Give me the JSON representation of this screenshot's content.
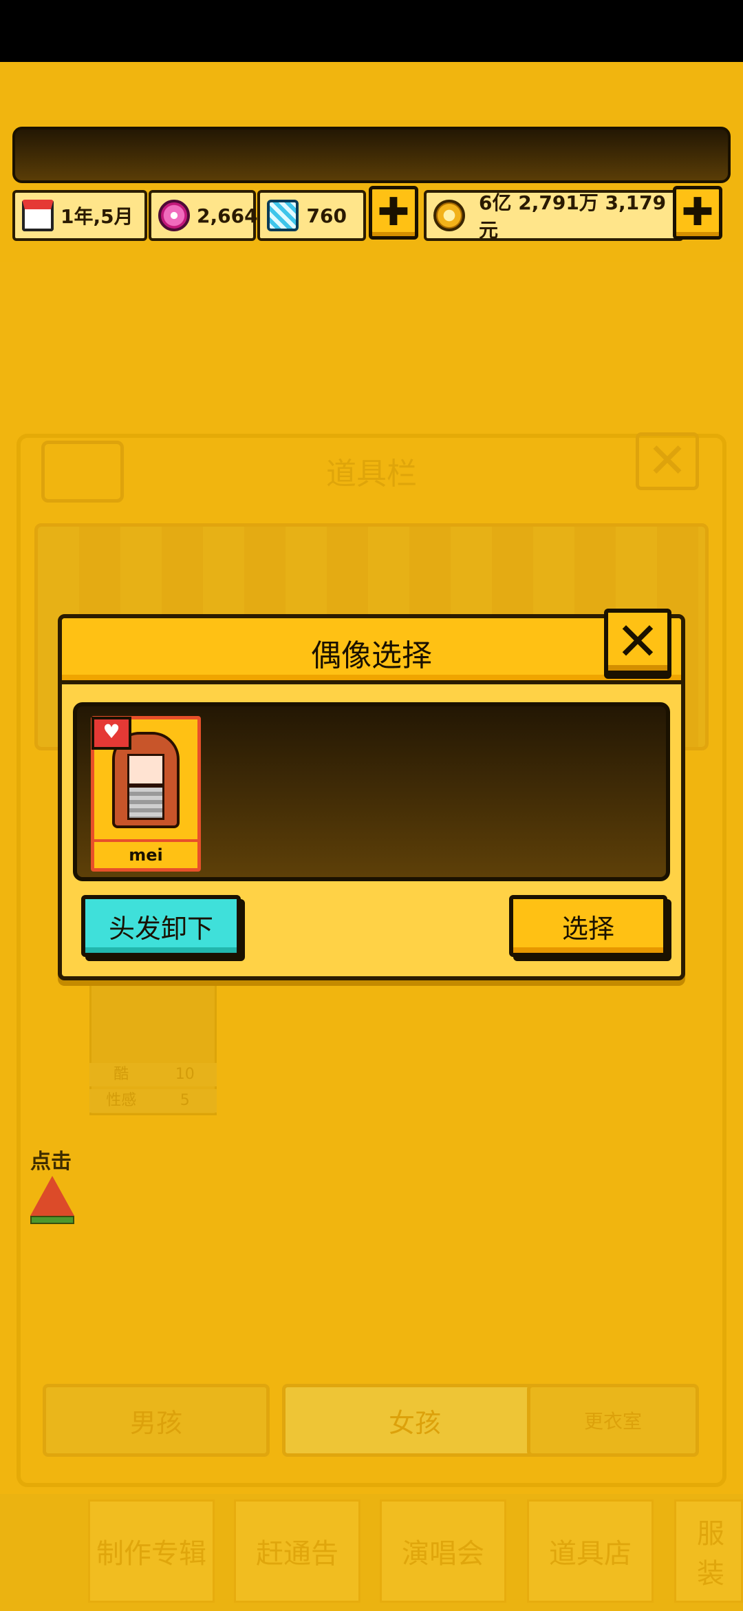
{
  "status_bar": {},
  "resources": {
    "date": "1年,5月",
    "gems": "2,664",
    "diamonds": "760",
    "money": "6亿 2,791万 3,179元",
    "add_label": "✚"
  },
  "background": {
    "toolbar_title": "道具栏",
    "idol_card_stats": [
      {
        "label": "酷",
        "value": "10"
      },
      {
        "label": "性感",
        "value": "5"
      }
    ],
    "tap_hint": "点击",
    "tabs": [
      "男孩",
      "女孩",
      "更衣室"
    ],
    "nav": [
      "制作专辑",
      "赶通告",
      "演唱会",
      "道具店",
      "服装"
    ]
  },
  "dialog": {
    "title": "偶像选择",
    "close_label": "✕",
    "idols": [
      {
        "name": "mei",
        "badge": "♥"
      }
    ],
    "hair_button": "头发卸下",
    "select_button": "选择"
  }
}
